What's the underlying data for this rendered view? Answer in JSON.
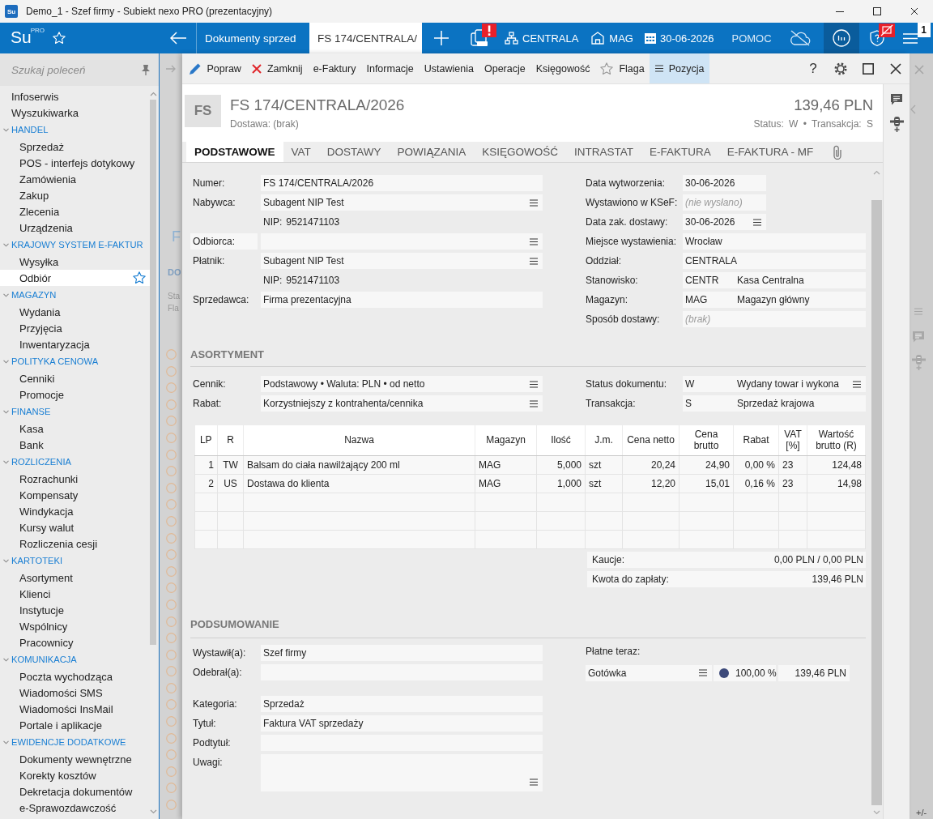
{
  "window": {
    "title": "Demo_1 - Szef firmy - Subiekt nexo PRO (prezentacyjny)",
    "app_icon": "Su"
  },
  "app_bar": {
    "logo": "Su",
    "logo_badge": "PRO",
    "tabs": [
      {
        "label": "Dokumenty sprzed",
        "selected": false
      },
      {
        "label": "FS 174/CENTRALA/",
        "selected": true
      }
    ],
    "items": [
      {
        "kind": "ksef",
        "alert": true
      },
      {
        "kind": "branch",
        "label": "CENTRALA",
        "alert": false
      },
      {
        "kind": "warehouse",
        "label": "MAG",
        "alert": false
      },
      {
        "kind": "calendar",
        "label": "30-06-2026",
        "alert": false
      },
      {
        "kind": "help",
        "label": "POMOC",
        "alert": false
      },
      {
        "kind": "cloud",
        "alert": false
      },
      {
        "kind": "ins",
        "alert": false
      },
      {
        "kind": "shield",
        "alert": true
      }
    ],
    "counter": "1"
  },
  "sidebar": {
    "search": {
      "placeholder": "Szukaj poleceń"
    },
    "items": [
      {
        "label": "Infoserwis",
        "selected": false
      },
      {
        "label": "Wyszukiwarka",
        "selected": false
      }
    ],
    "groups": [
      {
        "label": "HANDEL",
        "expanded": true,
        "children": [
          {
            "label": "Sprzedaż",
            "selected": false
          },
          {
            "label": "POS - interfejs dotykowy",
            "selected": false
          },
          {
            "label": "Zamówienia",
            "selected": false
          },
          {
            "label": "Zakup",
            "selected": false
          },
          {
            "label": "Zlecenia",
            "selected": false
          },
          {
            "label": "Urządzenia",
            "selected": false
          }
        ]
      },
      {
        "label": "KRAJOWY SYSTEM E-FAKTUR",
        "expanded": true,
        "children": [
          {
            "label": "Wysyłka",
            "selected": false
          },
          {
            "label": "Odbiór",
            "selected": true
          }
        ]
      },
      {
        "label": "MAGAZYN",
        "expanded": true,
        "children": [
          {
            "label": "Wydania",
            "selected": false
          },
          {
            "label": "Przyjęcia",
            "selected": false
          },
          {
            "label": "Inwentaryzacja",
            "selected": false
          }
        ]
      },
      {
        "label": "POLITYKA CENOWA",
        "expanded": true,
        "children": [
          {
            "label": "Cenniki",
            "selected": false
          },
          {
            "label": "Promocje",
            "selected": false
          }
        ]
      },
      {
        "label": "FINANSE",
        "expanded": true,
        "children": [
          {
            "label": "Kasa",
            "selected": false
          },
          {
            "label": "Bank",
            "selected": false
          }
        ]
      },
      {
        "label": "ROZLICZENIA",
        "expanded": true,
        "children": [
          {
            "label": "Rozrachunki",
            "selected": false
          },
          {
            "label": "Kompensaty",
            "selected": false
          },
          {
            "label": "Windykacja",
            "selected": false
          },
          {
            "label": "Kursy walut",
            "selected": false
          },
          {
            "label": "Rozliczenia cesji",
            "selected": false
          }
        ]
      },
      {
        "label": "KARTOTEKI",
        "expanded": true,
        "children": [
          {
            "label": "Asortyment",
            "selected": false
          },
          {
            "label": "Klienci",
            "selected": false
          },
          {
            "label": "Instytucje",
            "selected": false
          },
          {
            "label": "Wspólnicy",
            "selected": false
          },
          {
            "label": "Pracownicy",
            "selected": false
          }
        ]
      },
      {
        "label": "KOMUNIKACJA",
        "expanded": true,
        "children": [
          {
            "label": "Poczta wychodząca",
            "selected": false
          },
          {
            "label": "Wiadomości SMS",
            "selected": false
          },
          {
            "label": "Wiadomości InsMail",
            "selected": false
          },
          {
            "label": "Portale i aplikacje",
            "selected": false
          }
        ]
      },
      {
        "label": "EWIDENCJE DODATKOWE",
        "expanded": true,
        "children": [
          {
            "label": "Dokumenty wewnętrzne",
            "selected": false
          },
          {
            "label": "Korekty kosztów",
            "selected": false
          },
          {
            "label": "Dekretacja dokumentów",
            "selected": false
          },
          {
            "label": "e-Sprawozdawczość",
            "selected": false
          }
        ]
      }
    ]
  },
  "background": {
    "heading": "F",
    "section": "DO",
    "labels": [
      "Sta",
      "Fla"
    ],
    "footer": "+/-"
  },
  "document": {
    "toolbar": {
      "items": [
        {
          "kind": "edit",
          "label": "Popraw",
          "selected": false
        },
        {
          "kind": "close",
          "label": "Zamknij",
          "selected": false
        },
        {
          "kind": "plain",
          "label": "e-Faktury",
          "selected": false
        },
        {
          "kind": "plain",
          "label": "Informacje",
          "selected": false
        },
        {
          "kind": "plain",
          "label": "Ustawienia",
          "selected": false
        },
        {
          "kind": "plain",
          "label": "Operacje",
          "selected": false
        },
        {
          "kind": "plain",
          "label": "Księgowość",
          "selected": false
        },
        {
          "kind": "flag",
          "label": "Flaga",
          "selected": false
        },
        {
          "kind": "list",
          "label": "Pozycja",
          "selected": true
        }
      ],
      "help": "?"
    },
    "header": {
      "badge": "FS",
      "number": "FS 174/CENTRALA/2026",
      "delivery": "Dostawa: (brak)",
      "amount": "139,46 PLN",
      "status": "Status: W • Transakcja: S"
    },
    "tabs": [
      {
        "label": "PODSTAWOWE",
        "selected": true
      },
      {
        "label": "VAT",
        "selected": false
      },
      {
        "label": "DOSTAWY",
        "selected": false
      },
      {
        "label": "POWIĄZANIA",
        "selected": false
      },
      {
        "label": "KSIĘGOWOŚĆ",
        "selected": false
      },
      {
        "label": "INTRASTAT",
        "selected": false
      },
      {
        "label": "E-FAKTURA",
        "selected": false
      },
      {
        "label": "E-FAKTURA - MF",
        "selected": false
      }
    ],
    "details": {
      "left": [
        {
          "kind": "text",
          "label": "Numer:",
          "value": "FS 174/CENTRALA/2026"
        },
        {
          "kind": "select",
          "label": "Nabywca:",
          "value": "Subagent NIP Test"
        },
        {
          "kind": "plain",
          "prefix": "NIP:",
          "value": "9521471103"
        },
        {
          "kind": "boxed-select",
          "label": "Odbiorca:"
        },
        {
          "kind": "select",
          "label": "Płatnik:",
          "value": "Subagent NIP Test"
        },
        {
          "kind": "plain",
          "prefix": "NIP:",
          "value": "9521471103"
        },
        {
          "kind": "text",
          "label": "Sprzedawca:",
          "value": "Firma prezentacyjna"
        }
      ],
      "right": [
        {
          "kind": "short",
          "label": "Data wytworzenia:",
          "value": "30-06-2026"
        },
        {
          "kind": "short",
          "label": "Wystawiono w KSeF:",
          "placeholder": "(nie wysłano)"
        },
        {
          "kind": "short-select",
          "label": "Data zak. dostawy:",
          "value": "30-06-2026"
        },
        {
          "kind": "text",
          "label": "Miejsce wystawienia:",
          "value": "Wrocław"
        },
        {
          "kind": "text",
          "label": "Oddział:",
          "value": "CENTRALA"
        },
        {
          "kind": "coded",
          "label": "Stanowisko:",
          "code": "CENTR",
          "value": "Kasa Centralna"
        },
        {
          "kind": "coded",
          "label": "Magazyn:",
          "code": "MAG",
          "value": "Magazyn główny"
        },
        {
          "kind": "text",
          "label": "Sposób dostawy:",
          "placeholder": "(brak)"
        }
      ]
    },
    "assortment": {
      "title": "ASORTYMENT",
      "left": [
        {
          "kind": "select",
          "label": "Cennik:",
          "value": "Podstawowy • Waluta: PLN • od netto"
        },
        {
          "kind": "select",
          "label": "Rabat:",
          "value": "Korzystniejszy z kontrahenta/cennika"
        }
      ],
      "right": [
        {
          "kind": "coded-select",
          "label": "Status dokumentu:",
          "code": "W",
          "value": "Wydany towar i wykona"
        },
        {
          "kind": "coded",
          "label": "Transakcja:",
          "code": "S",
          "value": "Sprzedaż krajowa"
        }
      ],
      "table": {
        "columns": [
          "LP",
          "R",
          "Nazwa",
          "Magazyn",
          "Ilość",
          "J.m.",
          "Cena netto",
          "Cena brutto",
          "Rabat",
          "VAT [%]",
          "Wartość brutto (R)"
        ],
        "rows": [
          [
            "1",
            "TW",
            "Balsam do ciała nawilżający 200 ml",
            "MAG",
            "5,000",
            "szt",
            "20,24",
            "24,90",
            "0,00 %",
            "23",
            "124,48"
          ],
          [
            "2",
            "US",
            "Dostawa do klienta",
            "MAG",
            "1,000",
            "szt",
            "12,20",
            "15,01",
            "0,16 %",
            "23",
            "14,98"
          ]
        ]
      },
      "totals": [
        {
          "label": "Kaucje:",
          "value": "0,00 PLN / 0,00 PLN"
        },
        {
          "label": "Kwota do zapłaty:",
          "value": "139,46 PLN"
        }
      ]
    },
    "summary": {
      "title": "PODSUMOWANIE",
      "signatures": [
        {
          "kind": "text",
          "label": "Wystawił(a):",
          "value": "Szef firmy"
        },
        {
          "kind": "text",
          "label": "Odebrał(a):"
        }
      ],
      "description": [
        {
          "kind": "text",
          "label": "Kategoria:",
          "value": "Sprzedaż"
        },
        {
          "kind": "text",
          "label": "Tytuł:",
          "value": "Faktura VAT sprzedaży"
        },
        {
          "kind": "text",
          "label": "Podtytuł:"
        },
        {
          "kind": "memo",
          "label": "Uwagi:"
        }
      ],
      "payment": {
        "label": "Płatne teraz:",
        "rows": [
          {
            "method": "Gotówka",
            "share": "100,00 %",
            "amount": "139,46 PLN",
            "color": "#3d4a7a"
          }
        ]
      }
    }
  }
}
